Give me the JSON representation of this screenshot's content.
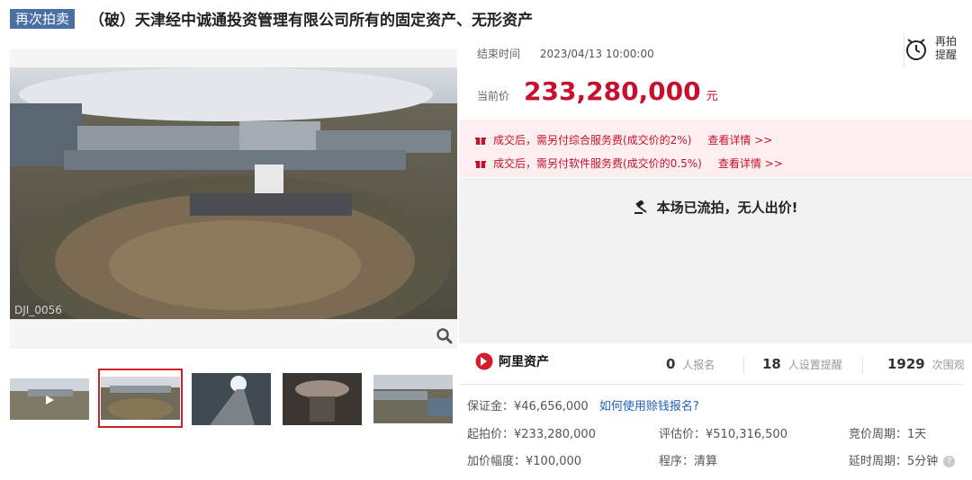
{
  "header": {
    "tag": "再次拍卖",
    "title": "（破）天津经中诚通投资管理有限公司所有的固定资产、无形资产"
  },
  "image": {
    "watermark": "DJI_0056"
  },
  "auction": {
    "end_label": "结束时间",
    "end_value": "2023/04/13 10:00:00",
    "reminder_line1": "再拍",
    "reminder_line2": "提醒",
    "price_label": "当前价",
    "price_value": "233,280,000",
    "price_unit": "元",
    "fees": [
      {
        "text": "成交后，需另付综合服务费(成交价的2%)",
        "link": "查看详情 >>"
      },
      {
        "text": "成交后，需另付软件服务费(成交价的0.5%)",
        "link": "查看详情 >>"
      }
    ],
    "status": "本场已流拍，无人出价!"
  },
  "stats": {
    "brand": "阿里资产",
    "signups_num": "0",
    "signups_label": "人报名",
    "reminders_num": "18",
    "reminders_label": "人设置提醒",
    "views_num": "1929",
    "views_label": "次围观"
  },
  "details": {
    "deposit_label": "保证金：¥46,656,000",
    "deposit_link": "如何使用赊钱报名?",
    "start_price": "起拍价：¥233,280,000",
    "appraisal": "评估价：¥510,316,500",
    "bid_cycle": "竞价周期：1天",
    "increment": "加价幅度：¥100,000",
    "procedure": "程序：清算",
    "delay_cycle": "延时周期：5分钟"
  },
  "colors": {
    "accent_red": "#c8102e",
    "tag_blue": "#4a6fa5",
    "link_blue": "#1f5fb8"
  }
}
